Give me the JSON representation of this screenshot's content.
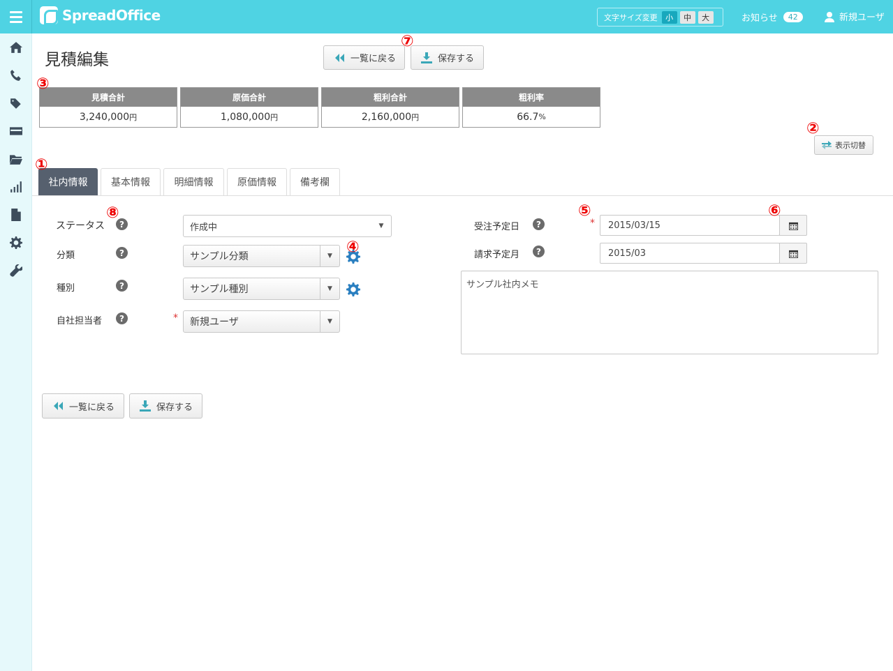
{
  "app": {
    "logo_text": "SpreadOffice",
    "font_size": {
      "label": "文字サイズ変更",
      "options": [
        "小",
        "中",
        "大"
      ],
      "selected": "小"
    },
    "notice": {
      "label": "お知らせ",
      "count": "42"
    },
    "user": {
      "name": "新規ユーザ"
    }
  },
  "sidebar": {
    "items": [
      "home-icon",
      "phone-icon",
      "tags-icon",
      "card-icon",
      "folder-icon",
      "chart-icon",
      "file-icon",
      "gear-icon",
      "wrench-icon"
    ]
  },
  "page": {
    "title": "見積編集",
    "back_label": "一覧に戻る",
    "save_label": "保存する"
  },
  "summary": [
    {
      "label": "見積合計",
      "value": "3,240,000",
      "unit": "円"
    },
    {
      "label": "原価合計",
      "value": "1,080,000",
      "unit": "円"
    },
    {
      "label": "粗利合計",
      "value": "2,160,000",
      "unit": "円"
    },
    {
      "label": "粗利率",
      "value": "66.7",
      "unit": "%"
    }
  ],
  "toggle_label": "表示切替",
  "tabs": [
    "社内情報",
    "基本情報",
    "明細情報",
    "原価情報",
    "備考欄"
  ],
  "active_tab": "社内情報",
  "form": {
    "status": {
      "label": "ステータス",
      "value": "作成中"
    },
    "category": {
      "label": "分類",
      "value": "サンプル分類"
    },
    "type": {
      "label": "種別",
      "value": "サンプル種別"
    },
    "owner": {
      "label": "自社担当者",
      "value": "新規ユーザ",
      "required": "*"
    },
    "order_date": {
      "label": "受注予定日",
      "value": "2015/03/15",
      "required": "*"
    },
    "billing_month": {
      "label": "請求予定月",
      "value": "2015/03"
    },
    "memo": "サンプル社内メモ"
  },
  "markers": [
    "①",
    "②",
    "③",
    "④",
    "⑤",
    "⑥",
    "⑦",
    "⑧"
  ],
  "colors": {
    "header": "#4fd3e3",
    "sidebar": "#e6f9fb",
    "active_tab": "#56606e",
    "marker": "#ee0000",
    "icon_blue": "#2a7fc0"
  }
}
